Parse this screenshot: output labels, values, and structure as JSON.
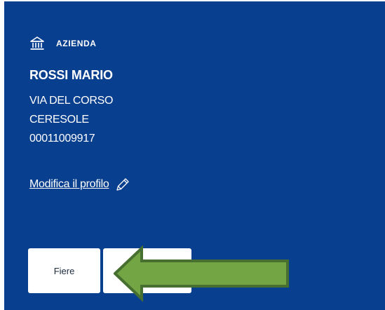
{
  "company_section": {
    "icon": "bank-icon",
    "title": "AZIENDA"
  },
  "profile": {
    "name": "ROSSI MARIO",
    "address": "VIA DEL CORSO",
    "city": "CERESOLE",
    "code": "00011009917"
  },
  "links": {
    "edit_profile": "Modifica il profilo",
    "edit_icon": "pencil-icon"
  },
  "tiles": [
    {
      "label": "Fiere"
    },
    {
      "label": ""
    }
  ],
  "colors": {
    "panel_background": "#083f8e",
    "text": "#ffffff",
    "tile_background": "#ffffff",
    "arrow_fill": "#73a545",
    "arrow_stroke": "#476f2f"
  }
}
